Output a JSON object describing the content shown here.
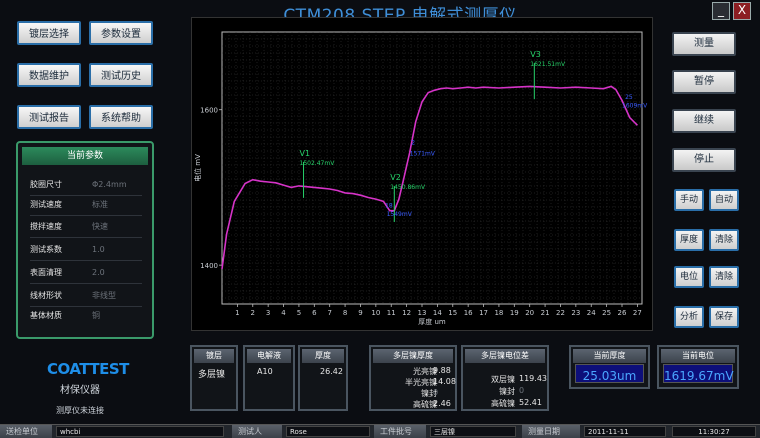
{
  "window": {
    "title": "CTM208 STEP 电解式测厚仪",
    "minimize": "_",
    "close": "X"
  },
  "left_menu": [
    {
      "label": "镀层选择"
    },
    {
      "label": "参数设置"
    },
    {
      "label": "数据维护"
    },
    {
      "label": "测试历史"
    },
    {
      "label": "测试报告"
    },
    {
      "label": "系统帮助"
    }
  ],
  "params": {
    "title": "当前参数",
    "rows": [
      {
        "label": "胶圈尺寸",
        "value": "Φ2.4mm"
      },
      {
        "label": "测试速度",
        "value": "标准"
      },
      {
        "label": "搅拌速度",
        "value": "快速"
      },
      {
        "label": "测试系数",
        "value": "1.0"
      },
      {
        "label": "表面清理",
        "value": "2.0"
      },
      {
        "label": "线材形状",
        "value": "非线型"
      },
      {
        "label": "基体材质",
        "value": "铜"
      }
    ]
  },
  "logo": {
    "brand": "COATTEST",
    "sub": "材保仪器",
    "status": "测厚仪未连接"
  },
  "right_buttons": {
    "measure": "测量",
    "pause": "暂停",
    "resume": "继续",
    "stop": "停止"
  },
  "mode_buttons": {
    "manual": "手动",
    "auto": "自动",
    "thickness": "厚度",
    "clear1": "清除",
    "potential": "电位",
    "clear2": "清除",
    "analysis": "分析",
    "save": "保存"
  },
  "bottom": {
    "plating": {
      "header": "镀层",
      "value": "多层镍"
    },
    "electrolyte": {
      "header": "电解液",
      "value": "A10"
    },
    "thickness": {
      "header": "厚度",
      "value": "26.42"
    },
    "multi_thickness": {
      "header": "多层镍厚度",
      "rows": [
        {
          "label": "光亮镍",
          "value": "9.88"
        },
        {
          "label": "半光亮镍",
          "value": "14.08"
        },
        {
          "label": "镍封",
          "value": "0"
        },
        {
          "label": "高硫镍",
          "value": "2.46"
        }
      ]
    },
    "multi_potential": {
      "header": "多层镍电位差",
      "rows": [
        {
          "label": "双层镍",
          "value": "119.43"
        },
        {
          "label": "镍封",
          "value": "0"
        },
        {
          "label": "高硫镍",
          "value": "52.41"
        }
      ]
    },
    "current_thickness": {
      "header": "当前厚度",
      "value": "25.03um"
    },
    "current_potential": {
      "header": "当前电位",
      "value": "1619.67mV"
    }
  },
  "status": {
    "unit_label": "送检单位",
    "unit_value": "whcbi",
    "tester_label": "测试人",
    "tester_value": "Rose",
    "batch_label": "工件批号",
    "batch_value": "三层镍",
    "date_label": "测量日期",
    "date_value": "2011-11-11",
    "time_value": "11:30:27"
  },
  "colors": {
    "accent": "#1e8ee8",
    "curve": "#d633c8",
    "marker_green": "#27d36a",
    "marker_blue": "#3a5cff",
    "lcd_bg": "#0d0f7a",
    "lcd_text": "#4aa6ff"
  },
  "chart_data": {
    "type": "line",
    "xlabel": "厚度 um",
    "ylabel": "电位 mV",
    "xlim": [
      0,
      27.3
    ],
    "ylim": [
      1350,
      1700
    ],
    "x_ticks": [
      1,
      2,
      3,
      4,
      5,
      6,
      7,
      8,
      9,
      10,
      11,
      12,
      13,
      14,
      15,
      16,
      17,
      18,
      19,
      20,
      21,
      22,
      23,
      24,
      25,
      26,
      27
    ],
    "y_ticks": [
      1400,
      1600
    ],
    "grid": true,
    "series": [
      {
        "x": [
          0,
          0.3,
          0.8,
          1.5,
          2,
          2.5,
          3,
          3.5,
          4,
          4.5,
          5,
          5.5,
          6,
          6.5,
          7,
          7.5,
          8,
          8.5,
          9,
          9.5,
          10,
          10.5,
          10.9,
          11.2,
          11.5,
          11.8,
          12.2,
          12.6,
          13,
          13.4,
          13.8,
          14.2,
          14.6,
          15,
          15.5,
          16,
          16.5,
          17,
          18,
          19,
          20,
          21,
          22,
          23,
          24,
          24.8,
          25.3,
          25.6,
          26,
          26.5,
          27
        ],
        "y": [
          1395,
          1440,
          1482,
          1505,
          1510,
          1508,
          1507,
          1506,
          1503,
          1500,
          1502,
          1501,
          1500,
          1499,
          1498,
          1496,
          1493,
          1492,
          1490,
          1487,
          1485,
          1482,
          1470,
          1470,
          1485,
          1510,
          1545,
          1585,
          1610,
          1622,
          1625,
          1627,
          1628,
          1627,
          1628,
          1629,
          1628,
          1629,
          1628,
          1629,
          1630,
          1629,
          1628,
          1629,
          1628,
          1627,
          1630,
          1626,
          1612,
          1590,
          1580
        ]
      }
    ],
    "markers": [
      {
        "name": "V1",
        "label": "1502.47mV",
        "x": 5.3,
        "y": 1502,
        "color": "green"
      },
      {
        "name": "V2",
        "label": "1450.86mV",
        "x": 11.2,
        "y": 1471,
        "color": "green"
      },
      {
        "name": "V3",
        "label": "1621.51mV",
        "x": 20.3,
        "y": 1629,
        "color": "green"
      }
    ],
    "annotations": [
      {
        "label": "18",
        "x": 10.6,
        "y": 1474
      },
      {
        "label": "1549mV",
        "x": 10.7,
        "y": 1463
      },
      {
        "label": "2",
        "x": 12.3,
        "y": 1555
      },
      {
        "label": "1571mV",
        "x": 12.2,
        "y": 1541
      },
      {
        "label": "25",
        "x": 26.2,
        "y": 1614
      },
      {
        "label": "1609mV",
        "x": 26.0,
        "y": 1603
      }
    ]
  }
}
